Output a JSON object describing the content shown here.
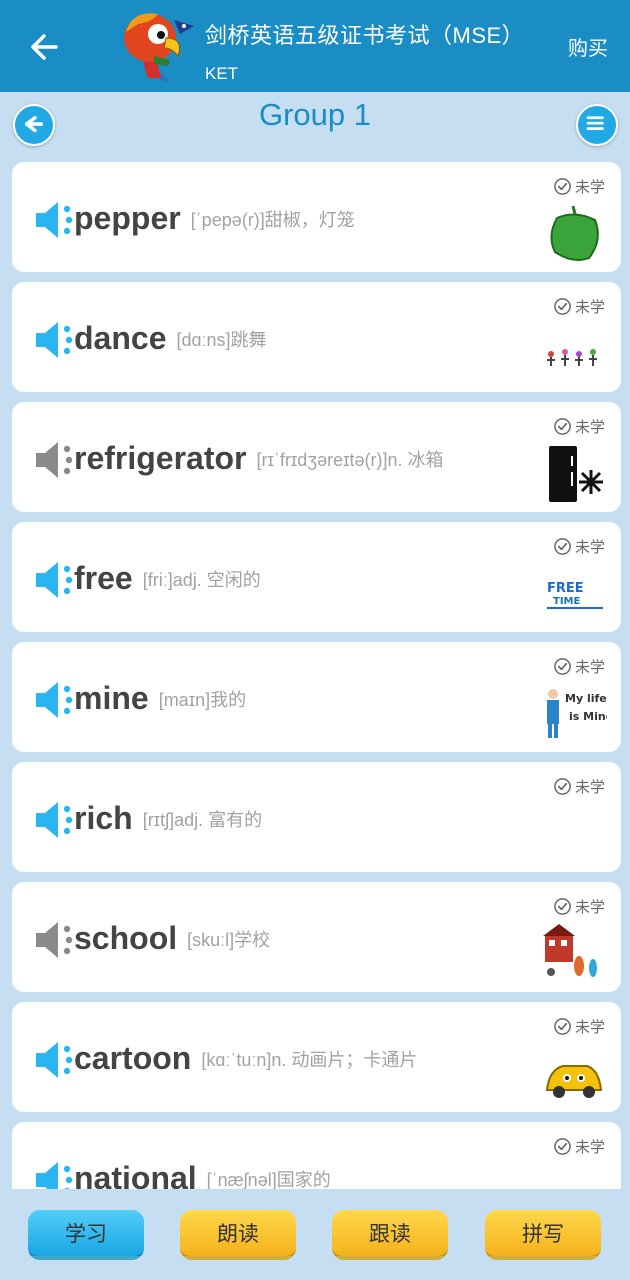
{
  "header": {
    "back_icon": "arrow-left-icon",
    "title": "剑桥英语五级证书考试（MSE）",
    "subtitle": "KET",
    "buy_label": "购买"
  },
  "group": {
    "title": "Group 1",
    "back_icon": "circle-arrow-left-icon",
    "menu_icon": "hamburger-menu-icon"
  },
  "words": [
    {
      "word": "pepper",
      "meaning": "[ˈpepə(r)]甜椒，灯笼",
      "status": "未学",
      "speaker_active": true,
      "image": "pepper-image"
    },
    {
      "word": "dance",
      "meaning": "[dɑːns]跳舞",
      "status": "未学",
      "speaker_active": true,
      "image": "dancers-image"
    },
    {
      "word": "refrigerator",
      "meaning": "[rɪˈfrɪdʒəreɪtə(r)]n. 冰箱",
      "status": "未学",
      "speaker_active": false,
      "image": "fridge-image"
    },
    {
      "word": "free",
      "meaning": "[friː]adj. 空闲的",
      "status": "未学",
      "speaker_active": true,
      "image": "free-time-image"
    },
    {
      "word": "mine",
      "meaning": "[maɪn]我的",
      "status": "未学",
      "speaker_active": true,
      "image": "my-life-image"
    },
    {
      "word": "rich",
      "meaning": "[rɪtʃ]adj. 富有的",
      "status": "未学",
      "speaker_active": true,
      "image": ""
    },
    {
      "word": "school",
      "meaning": "[skuːl]学校",
      "status": "未学",
      "speaker_active": false,
      "image": "school-image"
    },
    {
      "word": "cartoon",
      "meaning": "[kɑːˈtuːn]n. 动画片；卡通片",
      "status": "未学",
      "speaker_active": true,
      "image": "cartoon-car-image"
    },
    {
      "word": "national",
      "meaning": "[ˈnæʃnəl]国家的",
      "status": "未学",
      "speaker_active": true,
      "image": "flags-image"
    }
  ],
  "tabs": [
    {
      "label": "学习",
      "active": true
    },
    {
      "label": "朗读",
      "active": false
    },
    {
      "label": "跟读",
      "active": false
    },
    {
      "label": "拼写",
      "active": false
    }
  ],
  "colors": {
    "header_bg": "#1a8dc4",
    "page_bg": "#c6def1",
    "speaker_active": "#29b6f2",
    "speaker_inactive": "#8a8a8a",
    "tab_active": "#19a6e4",
    "tab_inactive": "#f5b21b"
  }
}
